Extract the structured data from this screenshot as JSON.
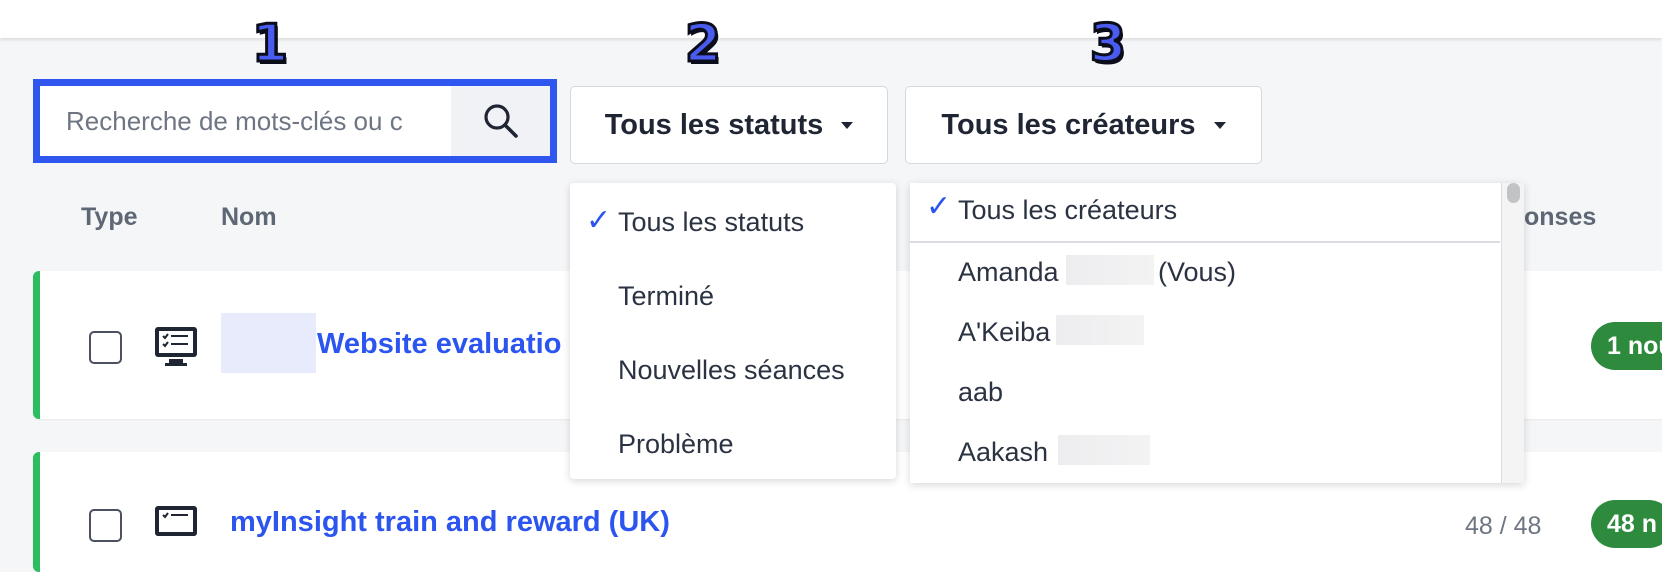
{
  "annotations": [
    "1",
    "2",
    "3"
  ],
  "search": {
    "placeholder": "Recherche de mots-clés ou c",
    "icon": "search-icon"
  },
  "filters": {
    "status_label": "Tous les statuts",
    "creator_label": "Tous les créateurs"
  },
  "columns": {
    "type": "Type",
    "name": "Nom",
    "responses_partial": "onses"
  },
  "rows": [
    {
      "name": "Website evaluatio",
      "badge": "1 nou",
      "count": ""
    },
    {
      "name": "myInsight train and reward (UK)",
      "badge": "48 n",
      "count": "48 / 48"
    }
  ],
  "status_menu": {
    "items": [
      {
        "label": "Tous les statuts",
        "checked": true
      },
      {
        "label": "Terminé",
        "checked": false
      },
      {
        "label": "Nouvelles séances",
        "checked": false
      },
      {
        "label": "Problème",
        "checked": false
      }
    ]
  },
  "creator_menu": {
    "items": [
      {
        "first": "Tous les créateurs",
        "suffix": "",
        "checked": true
      },
      {
        "first": "Amanda",
        "suffix": "(Vous)",
        "checked": false
      },
      {
        "first": "A'Keiba",
        "suffix": "",
        "checked": false
      },
      {
        "first": "aab",
        "suffix": "",
        "checked": false
      },
      {
        "first": "Aakash",
        "suffix": "",
        "checked": false
      }
    ]
  },
  "colors": {
    "accent_blue": "#2c55f0",
    "annotation_blue": "#4a5cf0",
    "status_green": "#2dbc5f",
    "badge_green": "#2e8b3e"
  }
}
